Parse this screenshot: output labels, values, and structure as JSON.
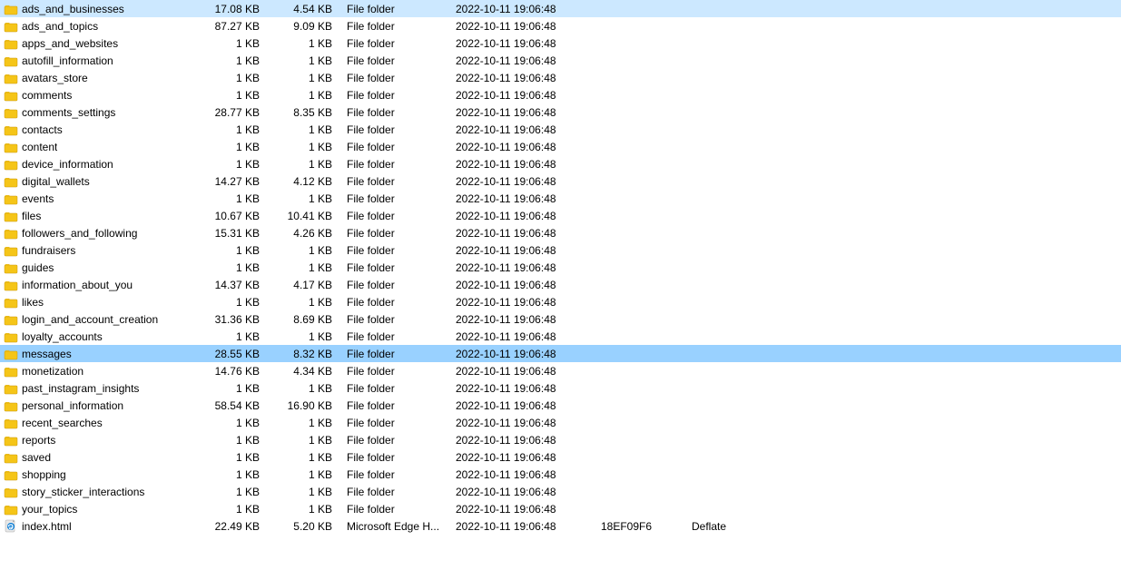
{
  "files": [
    {
      "name": "ads_and_businesses",
      "size": "17.08 KB",
      "packed": "4.54 KB",
      "type": "File folder",
      "modified": "2022-10-11 19:06:48",
      "crc": "",
      "method": "",
      "icon": "folder",
      "selected": false
    },
    {
      "name": "ads_and_topics",
      "size": "87.27 KB",
      "packed": "9.09 KB",
      "type": "File folder",
      "modified": "2022-10-11 19:06:48",
      "crc": "",
      "method": "",
      "icon": "folder",
      "selected": false
    },
    {
      "name": "apps_and_websites",
      "size": "1 KB",
      "packed": "1 KB",
      "type": "File folder",
      "modified": "2022-10-11 19:06:48",
      "crc": "",
      "method": "",
      "icon": "folder",
      "selected": false
    },
    {
      "name": "autofill_information",
      "size": "1 KB",
      "packed": "1 KB",
      "type": "File folder",
      "modified": "2022-10-11 19:06:48",
      "crc": "",
      "method": "",
      "icon": "folder",
      "selected": false
    },
    {
      "name": "avatars_store",
      "size": "1 KB",
      "packed": "1 KB",
      "type": "File folder",
      "modified": "2022-10-11 19:06:48",
      "crc": "",
      "method": "",
      "icon": "folder",
      "selected": false
    },
    {
      "name": "comments",
      "size": "1 KB",
      "packed": "1 KB",
      "type": "File folder",
      "modified": "2022-10-11 19:06:48",
      "crc": "",
      "method": "",
      "icon": "folder",
      "selected": false
    },
    {
      "name": "comments_settings",
      "size": "28.77 KB",
      "packed": "8.35 KB",
      "type": "File folder",
      "modified": "2022-10-11 19:06:48",
      "crc": "",
      "method": "",
      "icon": "folder",
      "selected": false
    },
    {
      "name": "contacts",
      "size": "1 KB",
      "packed": "1 KB",
      "type": "File folder",
      "modified": "2022-10-11 19:06:48",
      "crc": "",
      "method": "",
      "icon": "folder",
      "selected": false
    },
    {
      "name": "content",
      "size": "1 KB",
      "packed": "1 KB",
      "type": "File folder",
      "modified": "2022-10-11 19:06:48",
      "crc": "",
      "method": "",
      "icon": "folder",
      "selected": false
    },
    {
      "name": "device_information",
      "size": "1 KB",
      "packed": "1 KB",
      "type": "File folder",
      "modified": "2022-10-11 19:06:48",
      "crc": "",
      "method": "",
      "icon": "folder",
      "selected": false
    },
    {
      "name": "digital_wallets",
      "size": "14.27 KB",
      "packed": "4.12 KB",
      "type": "File folder",
      "modified": "2022-10-11 19:06:48",
      "crc": "",
      "method": "",
      "icon": "folder",
      "selected": false
    },
    {
      "name": "events",
      "size": "1 KB",
      "packed": "1 KB",
      "type": "File folder",
      "modified": "2022-10-11 19:06:48",
      "crc": "",
      "method": "",
      "icon": "folder",
      "selected": false
    },
    {
      "name": "files",
      "size": "10.67 KB",
      "packed": "10.41 KB",
      "type": "File folder",
      "modified": "2022-10-11 19:06:48",
      "crc": "",
      "method": "",
      "icon": "folder",
      "selected": false
    },
    {
      "name": "followers_and_following",
      "size": "15.31 KB",
      "packed": "4.26 KB",
      "type": "File folder",
      "modified": "2022-10-11 19:06:48",
      "crc": "",
      "method": "",
      "icon": "folder",
      "selected": false
    },
    {
      "name": "fundraisers",
      "size": "1 KB",
      "packed": "1 KB",
      "type": "File folder",
      "modified": "2022-10-11 19:06:48",
      "crc": "",
      "method": "",
      "icon": "folder",
      "selected": false
    },
    {
      "name": "guides",
      "size": "1 KB",
      "packed": "1 KB",
      "type": "File folder",
      "modified": "2022-10-11 19:06:48",
      "crc": "",
      "method": "",
      "icon": "folder",
      "selected": false
    },
    {
      "name": "information_about_you",
      "size": "14.37 KB",
      "packed": "4.17 KB",
      "type": "File folder",
      "modified": "2022-10-11 19:06:48",
      "crc": "",
      "method": "",
      "icon": "folder",
      "selected": false
    },
    {
      "name": "likes",
      "size": "1 KB",
      "packed": "1 KB",
      "type": "File folder",
      "modified": "2022-10-11 19:06:48",
      "crc": "",
      "method": "",
      "icon": "folder",
      "selected": false
    },
    {
      "name": "login_and_account_creation",
      "size": "31.36 KB",
      "packed": "8.69 KB",
      "type": "File folder",
      "modified": "2022-10-11 19:06:48",
      "crc": "",
      "method": "",
      "icon": "folder",
      "selected": false
    },
    {
      "name": "loyalty_accounts",
      "size": "1 KB",
      "packed": "1 KB",
      "type": "File folder",
      "modified": "2022-10-11 19:06:48",
      "crc": "",
      "method": "",
      "icon": "folder",
      "selected": false
    },
    {
      "name": "messages",
      "size": "28.55 KB",
      "packed": "8.32 KB",
      "type": "File folder",
      "modified": "2022-10-11 19:06:48",
      "crc": "",
      "method": "",
      "icon": "folder",
      "selected": true
    },
    {
      "name": "monetization",
      "size": "14.76 KB",
      "packed": "4.34 KB",
      "type": "File folder",
      "modified": "2022-10-11 19:06:48",
      "crc": "",
      "method": "",
      "icon": "folder",
      "selected": false
    },
    {
      "name": "past_instagram_insights",
      "size": "1 KB",
      "packed": "1 KB",
      "type": "File folder",
      "modified": "2022-10-11 19:06:48",
      "crc": "",
      "method": "",
      "icon": "folder",
      "selected": false
    },
    {
      "name": "personal_information",
      "size": "58.54 KB",
      "packed": "16.90 KB",
      "type": "File folder",
      "modified": "2022-10-11 19:06:48",
      "crc": "",
      "method": "",
      "icon": "folder",
      "selected": false
    },
    {
      "name": "recent_searches",
      "size": "1 KB",
      "packed": "1 KB",
      "type": "File folder",
      "modified": "2022-10-11 19:06:48",
      "crc": "",
      "method": "",
      "icon": "folder",
      "selected": false
    },
    {
      "name": "reports",
      "size": "1 KB",
      "packed": "1 KB",
      "type": "File folder",
      "modified": "2022-10-11 19:06:48",
      "crc": "",
      "method": "",
      "icon": "folder",
      "selected": false
    },
    {
      "name": "saved",
      "size": "1 KB",
      "packed": "1 KB",
      "type": "File folder",
      "modified": "2022-10-11 19:06:48",
      "crc": "",
      "method": "",
      "icon": "folder",
      "selected": false
    },
    {
      "name": "shopping",
      "size": "1 KB",
      "packed": "1 KB",
      "type": "File folder",
      "modified": "2022-10-11 19:06:48",
      "crc": "",
      "method": "",
      "icon": "folder",
      "selected": false
    },
    {
      "name": "story_sticker_interactions",
      "size": "1 KB",
      "packed": "1 KB",
      "type": "File folder",
      "modified": "2022-10-11 19:06:48",
      "crc": "",
      "method": "",
      "icon": "folder",
      "selected": false
    },
    {
      "name": "your_topics",
      "size": "1 KB",
      "packed": "1 KB",
      "type": "File folder",
      "modified": "2022-10-11 19:06:48",
      "crc": "",
      "method": "",
      "icon": "folder",
      "selected": false
    },
    {
      "name": "index.html",
      "size": "22.49 KB",
      "packed": "5.20 KB",
      "type": "Microsoft Edge H...",
      "modified": "2022-10-11 19:06:48",
      "crc": "18EF09F6",
      "method": "Deflate",
      "icon": "edge-file",
      "selected": false
    }
  ]
}
